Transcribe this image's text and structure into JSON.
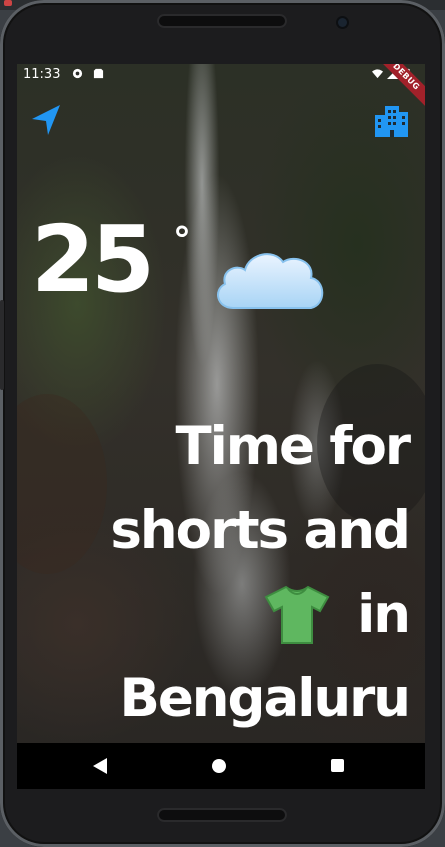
{
  "status_bar": {
    "time": "11:33",
    "debug_label": "DEBUG"
  },
  "weather": {
    "temperature": "25",
    "degree_symbol": "°",
    "condition_icon": "cloud-icon",
    "message_line1": "Time for",
    "message_line2": "shorts and",
    "message_line3_suffix": "in",
    "message_line4": "Bengaluru",
    "clothing_icon": "tshirt-icon"
  },
  "top_actions": {
    "location_icon": "navigation-arrow-icon",
    "city_icon": "city-buildings-icon"
  },
  "colors": {
    "accent_blue": "#2196f3",
    "shirt_green": "#5fb760",
    "text": "#ffffff"
  }
}
